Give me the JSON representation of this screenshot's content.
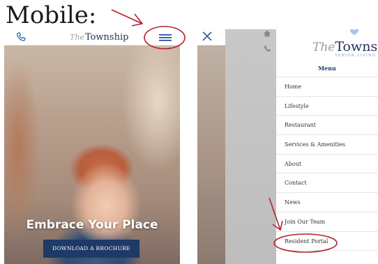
{
  "annotation": {
    "heading": "Mobile:"
  },
  "left_phone": {
    "logo_the": "The",
    "logo_name": "Township",
    "logo_sub": "SENIOR LIVING",
    "hero_title": "Embrace Your Place",
    "brochure_button": "DOWNLOAD A BROCHURE"
  },
  "right_phone": {
    "logo_the": "The",
    "logo_name": "Townsh",
    "logo_sub": "SENIOR LIVING",
    "menu_title": "Menu",
    "menu_items": [
      "Home",
      "Lifestyle",
      "Restaurant",
      "Services & Amenities",
      "About",
      "Contact",
      "News",
      "Join Our Team",
      "Resident Portal"
    ]
  },
  "colors": {
    "annotation_red": "#b3202d",
    "brand_navy": "#1e3a66",
    "icon_blue": "#3a67a8"
  }
}
